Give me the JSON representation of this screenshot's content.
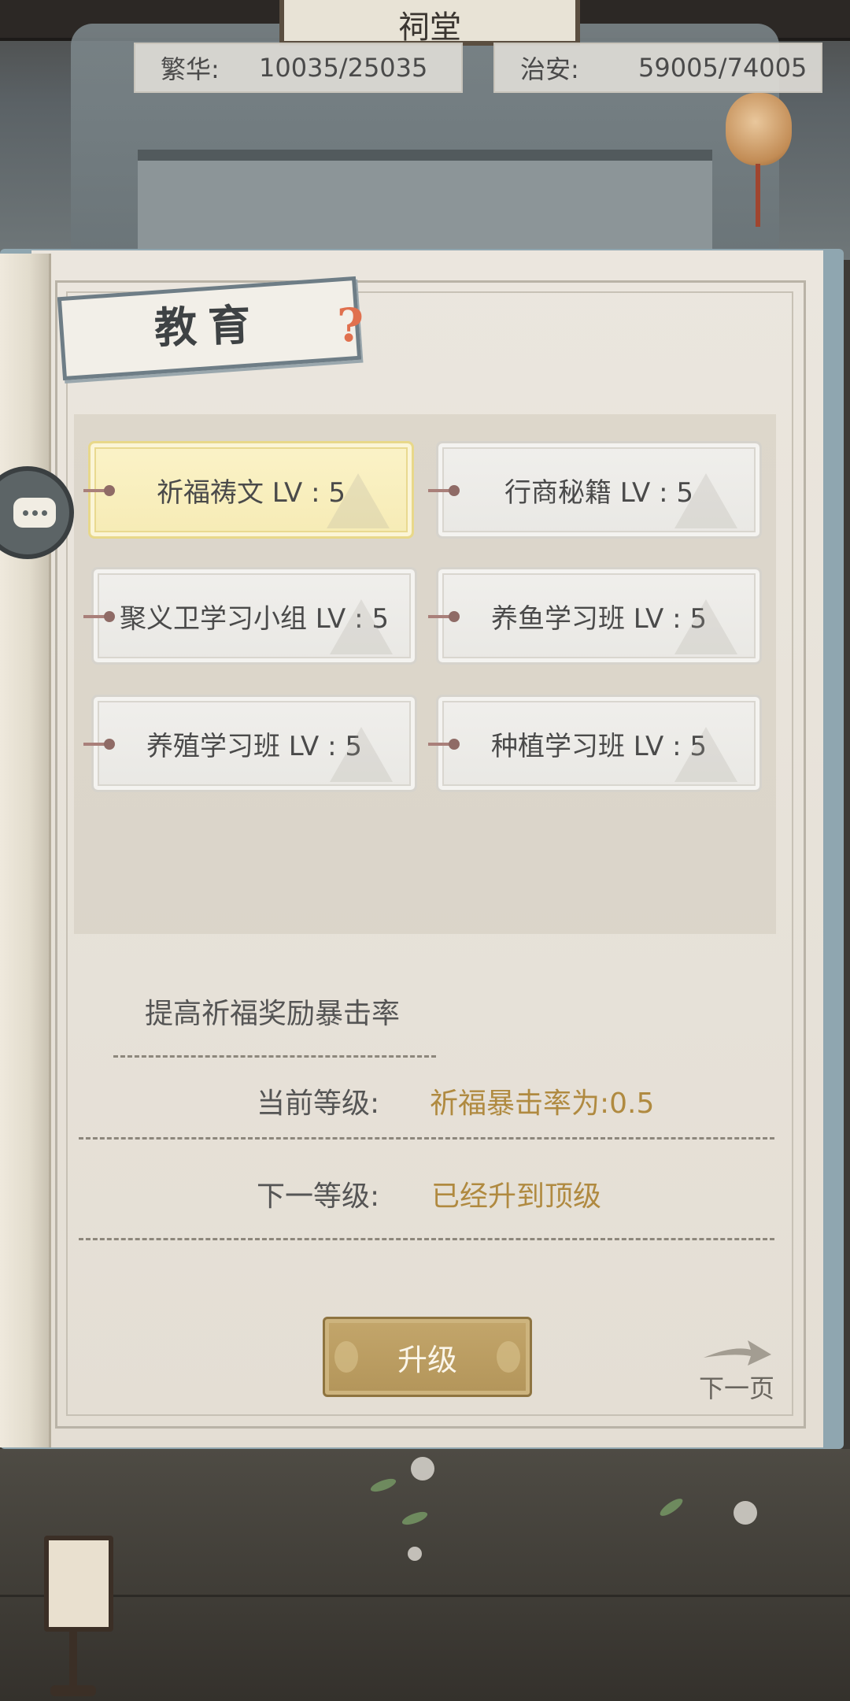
{
  "scene": {
    "plaque_text": "祠堂"
  },
  "resources": {
    "prosperity": {
      "label": "繁华:",
      "value": "10035/25035"
    },
    "security": {
      "label": "治安:",
      "value": "59005/74005"
    }
  },
  "panel": {
    "title": "教育",
    "help_icon": "?"
  },
  "skills": [
    {
      "label": "祈福祷文 LV : 5",
      "selected": true
    },
    {
      "label": "行商秘籍 LV : 5",
      "selected": false
    },
    {
      "label": "聚义卫学习小组 LV : 5",
      "selected": false
    },
    {
      "label": "养鱼学习班 LV : 5",
      "selected": false
    },
    {
      "label": "养殖学习班 LV : 5",
      "selected": false
    },
    {
      "label": "种植学习班 LV : 5",
      "selected": false
    }
  ],
  "detail": {
    "description": "提高祈福奖励暴击率",
    "current_label": "当前等级:",
    "current_value": "祈福暴击率为:0.5",
    "next_label": "下一等级:",
    "next_value": "已经升到顶级"
  },
  "actions": {
    "upgrade_label": "升级",
    "next_page_label": "下一页"
  },
  "colors": {
    "accent_gold": "#b08a40",
    "selected_card": "#fbf3c8",
    "help_icon": "#e0704e"
  },
  "icons": {
    "chat": "chat-bubble-icon",
    "next_page": "arrow-right-icon",
    "help": "help-question-icon"
  }
}
